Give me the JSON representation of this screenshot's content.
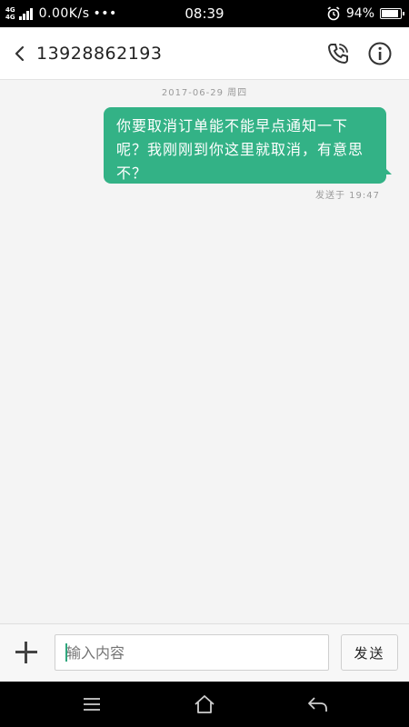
{
  "status_bar": {
    "network_label": "4G",
    "network_label_2": "4G",
    "speed": "0.00K/s",
    "more": "•••",
    "time": "08:39",
    "battery_percent": "94%",
    "battery_level": 0.94
  },
  "header": {
    "contact_number": "13928862193"
  },
  "conversation": {
    "date_label": "2017-06-29 周四",
    "messages": [
      {
        "text": "你要取消订单能不能早点通知一下呢？我刚刚到你这里就取消，有意思不？",
        "status": "发送于 19:47",
        "direction": "outgoing"
      }
    ]
  },
  "composer": {
    "placeholder": "输入内容",
    "send_label": "发送"
  },
  "colors": {
    "bubble": "#33b286",
    "accent": "#2fa77e"
  },
  "icons": {
    "back": "chevron-left-icon",
    "call": "phone-icon",
    "info": "info-icon",
    "attach": "plus-icon",
    "nav_menu": "menu-icon",
    "nav_home": "home-icon",
    "nav_back": "back-arrow-icon"
  }
}
